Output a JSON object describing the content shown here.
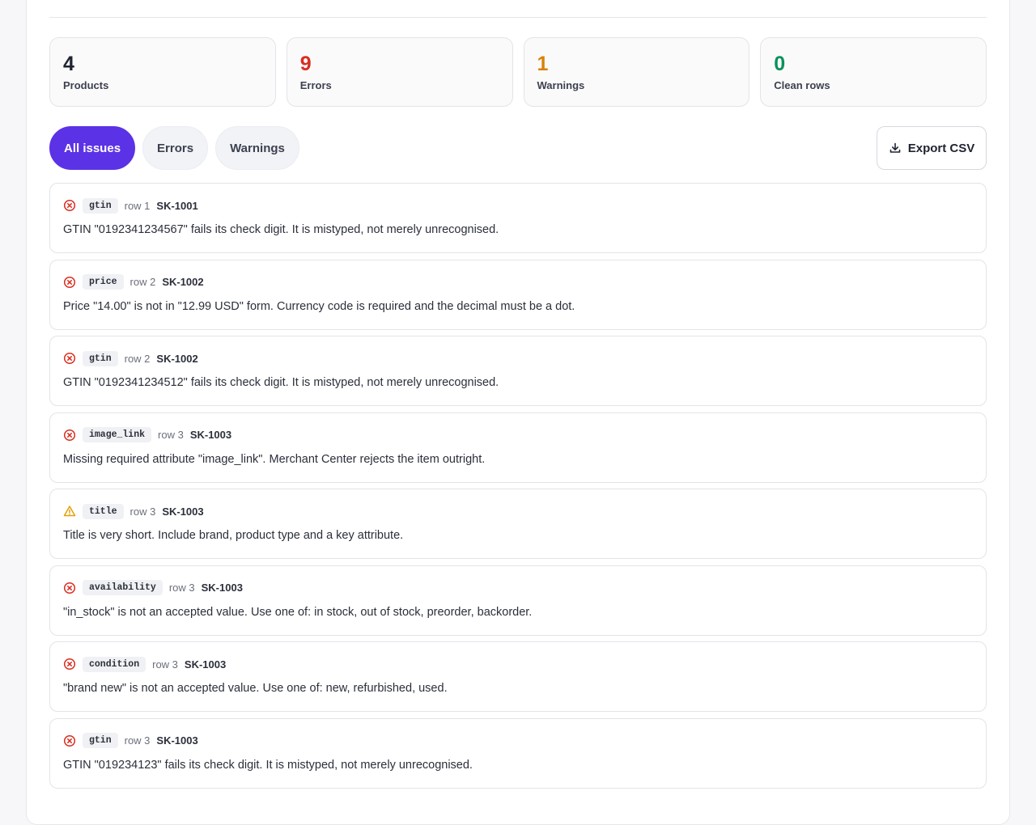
{
  "stats": [
    {
      "value": "4",
      "label": "Products",
      "color": "#1f2330"
    },
    {
      "value": "9",
      "label": "Errors",
      "color": "#d92d20"
    },
    {
      "value": "1",
      "label": "Warnings",
      "color": "#d98209"
    },
    {
      "value": "0",
      "label": "Clean rows",
      "color": "#07925a"
    }
  ],
  "filters": [
    {
      "label": "All issues",
      "active": true
    },
    {
      "label": "Errors",
      "active": false
    },
    {
      "label": "Warnings",
      "active": false
    }
  ],
  "export_label": "Export CSV",
  "colors": {
    "accent": "#5b32e6",
    "error": "#d92d20",
    "warning": "#e3a008"
  },
  "issues": [
    {
      "severity": "error",
      "icon": "error-circle-icon",
      "field": "gtin",
      "row": "row 1",
      "sku": "SK-1001",
      "message": "GTIN \"0192341234567\" fails its check digit. It is mistyped, not merely unrecognised."
    },
    {
      "severity": "error",
      "icon": "error-circle-icon",
      "field": "price",
      "row": "row 2",
      "sku": "SK-1002",
      "message": "Price \"14.00\" is not in \"12.99 USD\" form. Currency code is required and the decimal must be a dot."
    },
    {
      "severity": "error",
      "icon": "error-circle-icon",
      "field": "gtin",
      "row": "row 2",
      "sku": "SK-1002",
      "message": "GTIN \"0192341234512\" fails its check digit. It is mistyped, not merely unrecognised."
    },
    {
      "severity": "error",
      "icon": "error-circle-icon",
      "field": "image_link",
      "row": "row 3",
      "sku": "SK-1003",
      "message": "Missing required attribute \"image_link\". Merchant Center rejects the item outright."
    },
    {
      "severity": "warning",
      "icon": "warning-triangle-icon",
      "field": "title",
      "row": "row 3",
      "sku": "SK-1003",
      "message": "Title is very short. Include brand, product type and a key attribute."
    },
    {
      "severity": "error",
      "icon": "error-circle-icon",
      "field": "availability",
      "row": "row 3",
      "sku": "SK-1003",
      "message": "\"in_stock\" is not an accepted value. Use one of: in stock, out of stock, preorder, backorder."
    },
    {
      "severity": "error",
      "icon": "error-circle-icon",
      "field": "condition",
      "row": "row 3",
      "sku": "SK-1003",
      "message": "\"brand new\" is not an accepted value. Use one of: new, refurbished, used."
    },
    {
      "severity": "error",
      "icon": "error-circle-icon",
      "field": "gtin",
      "row": "row 3",
      "sku": "SK-1003",
      "message": "GTIN \"019234123\" fails its check digit. It is mistyped, not merely unrecognised."
    }
  ]
}
